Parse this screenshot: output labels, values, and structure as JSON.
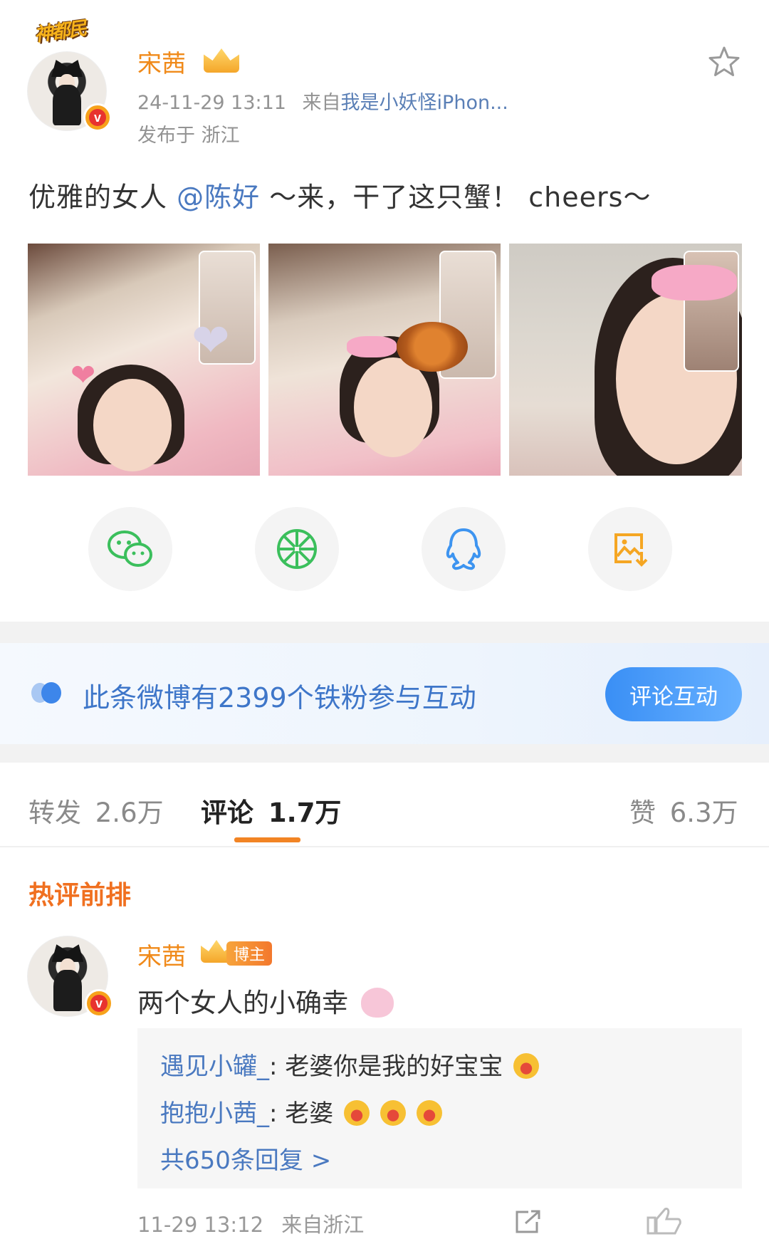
{
  "post": {
    "username": "宋茜",
    "avatar_tag": "神都民",
    "timestamp": "24-11-29 13:11",
    "source_prefix": "来自",
    "source": "我是小妖怪iPhon...",
    "location": "发布于 浙江",
    "text_prefix": "优雅的女人",
    "mention": "@陈好",
    "text_suffix": " ～来，干了这只蟹！ cheers～",
    "photos": [
      "photo-1",
      "photo-2",
      "photo-3"
    ]
  },
  "share": {
    "icons": [
      "wechat-icon",
      "moments-icon",
      "qq-icon",
      "save-image-icon"
    ],
    "colors": {
      "wechat": "#3bbf5c",
      "moments": "#3bbf5c",
      "qq": "#3d94f0",
      "save": "#f5a623"
    }
  },
  "fans_banner": {
    "text": "此条微博有2399个铁粉参与互动",
    "button": "评论互动"
  },
  "tabs": {
    "repost_label": "转发",
    "repost_count": "2.6万",
    "comment_label": "评论",
    "comment_count": "1.7万",
    "like_label": "赞",
    "like_count": "6.3万"
  },
  "comments": {
    "section_title": "热评前排",
    "top": {
      "username": "宋茜",
      "badge": "博主",
      "text": "两个女人的小确幸",
      "replies": [
        {
          "who": "遇见小罐_",
          "text": ": 老婆你是我的好宝宝"
        },
        {
          "who": "抱抱小茜_",
          "text": ": 老婆"
        }
      ],
      "more": "共650条回复 >",
      "time": "11-29 13:12",
      "from": "来自浙江"
    }
  },
  "colors": {
    "accent_orange": "#f08a1a",
    "link_blue": "#4a79c0"
  }
}
